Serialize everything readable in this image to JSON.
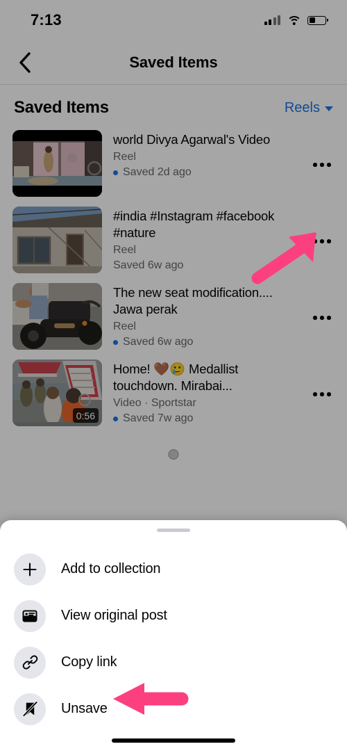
{
  "status_bar": {
    "time": "7:13",
    "cellular_icon": "cellular-signal-icon",
    "wifi_icon": "wifi-icon",
    "battery_icon": "battery-low-icon"
  },
  "nav": {
    "back_icon": "back-chevron-icon",
    "title": "Saved Items"
  },
  "section": {
    "title": "Saved Items",
    "filter_label": "Reels",
    "filter_caret_icon": "chevron-down-icon"
  },
  "saved_items": [
    {
      "title": "world Divya Agarwal's Video",
      "subtitle": "Reel",
      "saved": "Saved 2d ago",
      "unread_dot": true,
      "duration": "",
      "menu_icon": "overflow-menu-icon"
    },
    {
      "title": "#india #Instagram #facebook #nature",
      "subtitle": "Reel",
      "saved": "Saved 6w ago",
      "unread_dot": false,
      "duration": "",
      "menu_icon": "overflow-menu-icon"
    },
    {
      "title": "The new seat modification.... Jawa perak",
      "subtitle": "Reel",
      "saved": "Saved 6w ago",
      "unread_dot": true,
      "duration": "",
      "menu_icon": "overflow-menu-icon"
    },
    {
      "title": "Home! 🤎🥲 Medallist touchdown. Mirabai...",
      "subtitle": "Video · Sportstar",
      "saved": "Saved 7w ago",
      "unread_dot": true,
      "duration": "0:56",
      "menu_icon": "overflow-menu-icon"
    }
  ],
  "loading_indicator": "loading-spinner",
  "sheet": {
    "handle": "drag-handle",
    "options": [
      {
        "label": "Add to collection",
        "icon": "plus-icon"
      },
      {
        "label": "View original post",
        "icon": "post-card-icon"
      },
      {
        "label": "Copy link",
        "icon": "link-icon"
      },
      {
        "label": "Unsave",
        "icon": "unsave-bookmark-icon"
      }
    ]
  },
  "annotations": {
    "arrow_color": "#FC3F7F",
    "arrow_to_overflow_menu": "arrow-pointing-to-overflow-menu",
    "arrow_to_unsave": "arrow-pointing-to-unsave"
  },
  "colors": {
    "accent_blue": "#1b74e4",
    "text_primary": "#050505",
    "text_secondary": "#65676b",
    "sheet_icon_bg": "#e4e6eb",
    "dim_overlay": "rgba(0,0,0,0.35)"
  },
  "home_indicator": "home-indicator"
}
